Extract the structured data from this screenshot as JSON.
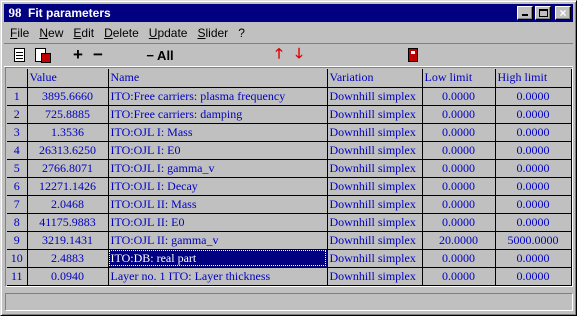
{
  "window": {
    "app_icon": "98",
    "title": "Fit parameters"
  },
  "menu": [
    "File",
    "New",
    "Edit",
    "Delete",
    "Update",
    "Slider",
    "?"
  ],
  "toolbar": {
    "plus": "+",
    "minus": "−",
    "minus_all": "− All",
    "up_icon": "arrow-up-icon",
    "down_icon": "arrow-down-icon"
  },
  "table": {
    "columns": [
      "",
      "Value",
      "Name",
      "Variation",
      "Low limit",
      "High limit"
    ],
    "rows": [
      {
        "n": "1",
        "value": "3895.6660",
        "name": "ITO:Free carriers: plasma frequency",
        "variation": "Downhill simplex",
        "low": "0.0000",
        "high": "0.0000"
      },
      {
        "n": "2",
        "value": "725.8885",
        "name": "ITO:Free carriers: damping",
        "variation": "Downhill simplex",
        "low": "0.0000",
        "high": "0.0000"
      },
      {
        "n": "3",
        "value": "1.3536",
        "name": "ITO:OJL I: Mass",
        "variation": "Downhill simplex",
        "low": "0.0000",
        "high": "0.0000"
      },
      {
        "n": "4",
        "value": "26313.6250",
        "name": "ITO:OJL I: E0",
        "variation": "Downhill simplex",
        "low": "0.0000",
        "high": "0.0000"
      },
      {
        "n": "5",
        "value": "2766.8071",
        "name": "ITO:OJL I: gamma_v",
        "variation": "Downhill simplex",
        "low": "0.0000",
        "high": "0.0000"
      },
      {
        "n": "6",
        "value": "12271.1426",
        "name": "ITO:OJL I: Decay",
        "variation": "Downhill simplex",
        "low": "0.0000",
        "high": "0.0000"
      },
      {
        "n": "7",
        "value": "2.0468",
        "name": "ITO:OJL II: Mass",
        "variation": "Downhill simplex",
        "low": "0.0000",
        "high": "0.0000"
      },
      {
        "n": "8",
        "value": "41175.9883",
        "name": "ITO:OJL II: E0",
        "variation": "Downhill simplex",
        "low": "0.0000",
        "high": "0.0000"
      },
      {
        "n": "9",
        "value": "3219.1431",
        "name": "ITO:OJL II: gamma_v",
        "variation": "Downhill simplex",
        "low": "20.0000",
        "high": "5000.0000"
      },
      {
        "n": "10",
        "value": "2.4883",
        "name": "ITO:DB: real part",
        "variation": "Downhill simplex",
        "low": "0.0000",
        "high": "0.0000"
      },
      {
        "n": "11",
        "value": "0.0940",
        "name": "Layer no.  1 ITO: Layer thickness",
        "variation": "Downhill simplex",
        "low": "0.0000",
        "high": "0.0000"
      }
    ],
    "selected_row": 9
  },
  "status": {
    "text": ""
  }
}
